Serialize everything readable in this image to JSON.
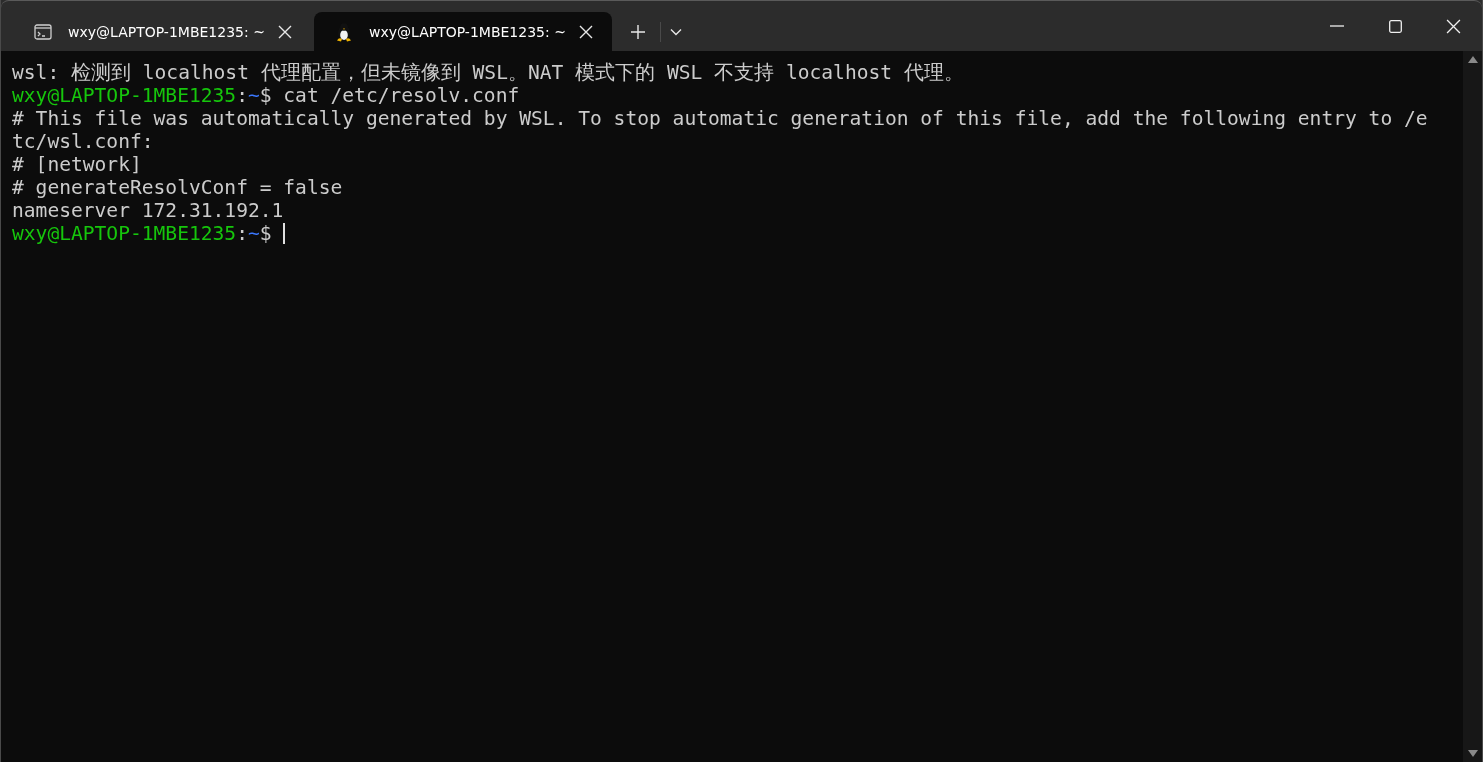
{
  "tabs": [
    {
      "title": "wxy@LAPTOP-1MBE1235: ~",
      "selected": false
    },
    {
      "title": "wxy@LAPTOP-1MBE1235: ~",
      "selected": true
    }
  ],
  "terminal": {
    "lines": [
      {
        "cursor": false,
        "segments": [
          {
            "kind": "text",
            "text": "wsl: 检测到 localhost 代理配置，但未镜像到 WSL。NAT 模式下的 WSL 不支持 localhost 代理。"
          }
        ]
      },
      {
        "cursor": false,
        "segments": [
          {
            "kind": "user",
            "text": "wxy@LAPTOP-1MBE1235"
          },
          {
            "kind": "text",
            "text": ":"
          },
          {
            "kind": "path",
            "text": "~"
          },
          {
            "kind": "text",
            "text": "$ cat /etc/resolv.conf"
          }
        ]
      },
      {
        "cursor": false,
        "segments": [
          {
            "kind": "text",
            "text": "# This file was automatically generated by WSL. To stop automatic generation of this file, add the following entry to /e"
          }
        ]
      },
      {
        "cursor": false,
        "segments": [
          {
            "kind": "text",
            "text": "tc/wsl.conf:"
          }
        ]
      },
      {
        "cursor": false,
        "segments": [
          {
            "kind": "text",
            "text": "# [network]"
          }
        ]
      },
      {
        "cursor": false,
        "segments": [
          {
            "kind": "text",
            "text": "# generateResolvConf = false"
          }
        ]
      },
      {
        "cursor": false,
        "segments": [
          {
            "kind": "text",
            "text": "nameserver 172.31.192.1"
          }
        ]
      },
      {
        "cursor": true,
        "segments": [
          {
            "kind": "user",
            "text": "wxy@LAPTOP-1MBE1235"
          },
          {
            "kind": "text",
            "text": ":"
          },
          {
            "kind": "path",
            "text": "~"
          },
          {
            "kind": "text",
            "text": "$ "
          }
        ]
      }
    ]
  }
}
